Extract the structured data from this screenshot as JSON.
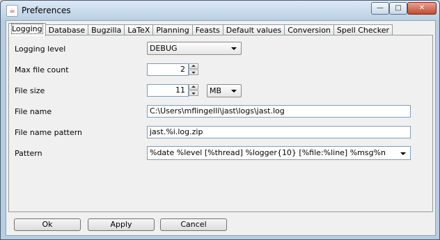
{
  "window": {
    "title": "Preferences",
    "app_icon": "java-icon",
    "minimize_glyph": "—",
    "maximize_glyph": "□",
    "close_glyph": "✕"
  },
  "tabs": [
    {
      "label": "Logging",
      "active": true
    },
    {
      "label": "Database"
    },
    {
      "label": "Bugzilla"
    },
    {
      "label": "LaTeX"
    },
    {
      "label": "Planning"
    },
    {
      "label": "Feasts"
    },
    {
      "label": "Default values"
    },
    {
      "label": "Conversion"
    },
    {
      "label": "Spell Checker"
    }
  ],
  "logging": {
    "level_label": "Logging level",
    "level_value": "DEBUG",
    "max_count_label": "Max file count",
    "max_count_value": "2",
    "file_size_label": "File size",
    "file_size_value": "11",
    "file_size_unit": "MB",
    "file_name_label": "File name",
    "file_name_value": "C:\\Users\\mflingelli\\jast\\logs\\jast.log",
    "file_pattern_label": "File name pattern",
    "file_pattern_value": "jast.%i.log.zip",
    "pattern_label": "Pattern",
    "pattern_value": "%date %level [%thread] %logger{10} [%file:%line] %msg%n"
  },
  "buttons": {
    "ok": "Ok",
    "apply": "Apply",
    "cancel": "Cancel"
  }
}
